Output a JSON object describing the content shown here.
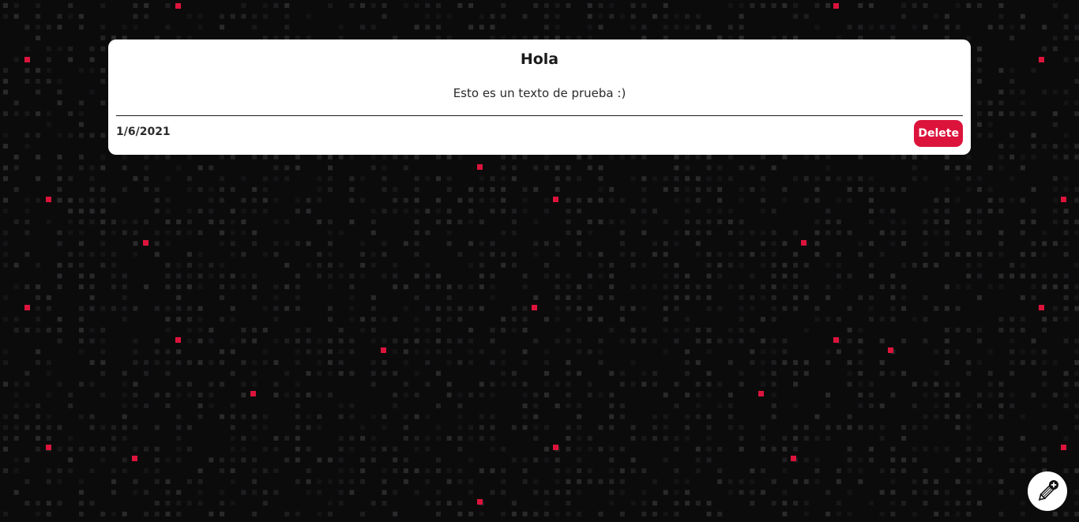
{
  "note": {
    "title": "Hola",
    "body": "Esto es un texto de prueba :)",
    "date": "1/6/2021",
    "delete_label": "Delete"
  },
  "fab": {
    "icon": "pencil-plus-icon"
  },
  "colors": {
    "background": "#0b0b0c",
    "accent": "#dc143c",
    "card": "#ffffff"
  }
}
